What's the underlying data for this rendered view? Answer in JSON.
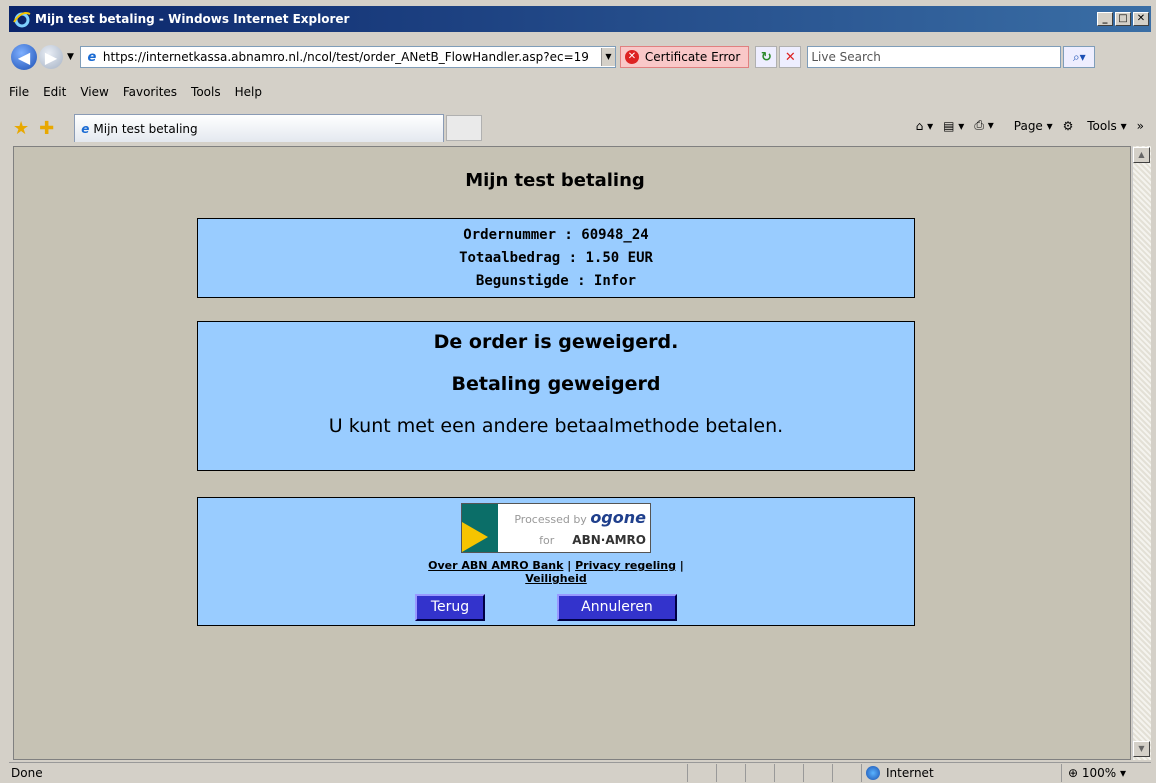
{
  "window": {
    "title": "Mijn test betaling - Windows Internet Explorer"
  },
  "address": {
    "url": "https://internetkassa.abnamro.nl./ncol/test/order_ANetB_FlowHandler.asp?ec=19",
    "cert_error": "Certificate Error",
    "search_placeholder": "Live Search"
  },
  "menu": [
    "File",
    "Edit",
    "View",
    "Favorites",
    "Tools",
    "Help"
  ],
  "tab": {
    "label": "Mijn test betaling"
  },
  "commands": {
    "page": "Page",
    "tools": "Tools"
  },
  "page": {
    "title": "Mijn test betaling",
    "order_line": "Ordernummer : 60948_24",
    "amount_line": "Totaalbedrag : 1.50 EUR",
    "beneficiary_line": "Begunstigde : Infor",
    "heading": "De order is geweigerd.",
    "subheading": "Betaling geweigerd",
    "message": "U kunt met een andere betaalmethode betalen.",
    "logo_processed": "Processed by",
    "logo_brand": "ogone",
    "logo_for": "for",
    "logo_bank": "ABN·AMRO",
    "link_about": "Over ABN AMRO Bank",
    "link_privacy": "Privacy regeling",
    "link_security": "Veiligheid",
    "separator": "|",
    "btn_back": "Terug",
    "btn_cancel": "Annuleren"
  },
  "status": {
    "text": "Done",
    "zone": "Internet",
    "zoom": "100%"
  }
}
